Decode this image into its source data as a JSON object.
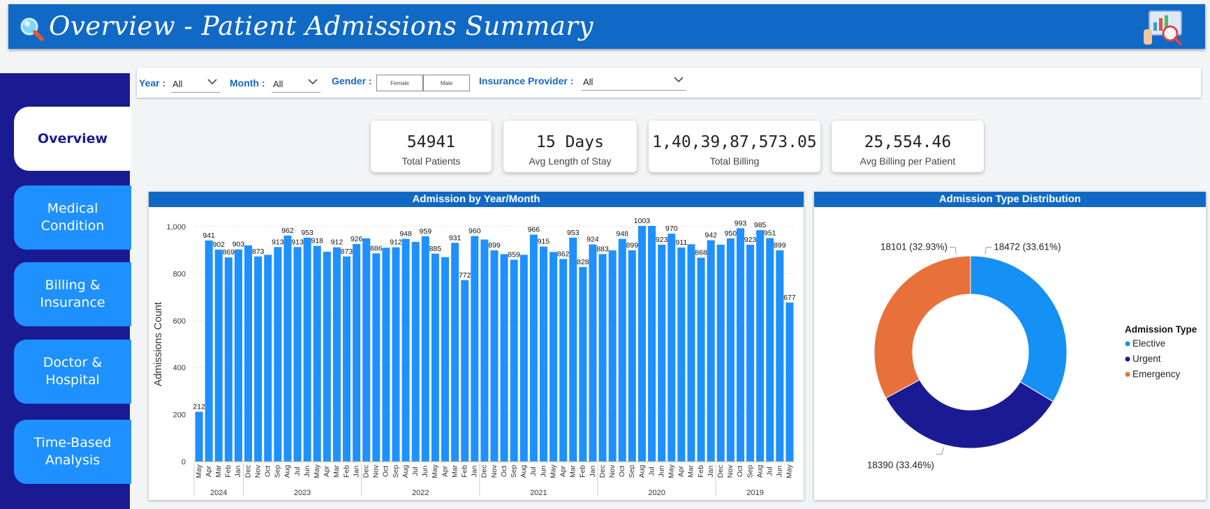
{
  "header": {
    "title": "Overview - Patient Admissions Summary",
    "left_icon": "magnifier-icon",
    "right_icon": "analytics-icon"
  },
  "sidebar": {
    "items": [
      {
        "label": "Overview",
        "active": true
      },
      {
        "label": "Medical\nCondition",
        "active": false
      },
      {
        "label": "Billing &\nInsurance",
        "active": false
      },
      {
        "label": "Doctor &\nHospital",
        "active": false
      },
      {
        "label": "Time-Based\nAnalysis",
        "active": false
      }
    ]
  },
  "filters": {
    "year_label": "Year :",
    "year_value": "All",
    "month_label": "Month :",
    "month_value": "All",
    "gender_label": "Gender :",
    "gender_options": [
      "Female",
      "Male"
    ],
    "insurance_label": "Insurance Provider :",
    "insurance_value": "All"
  },
  "kpis": [
    {
      "value": "54941",
      "label": "Total Patients"
    },
    {
      "value": "15 Days",
      "label": "Avg Length of Stay"
    },
    {
      "value": "1,40,39,87,573.05",
      "label": "Total Billing"
    },
    {
      "value": "25,554.46",
      "label": "Avg Billing per Patient"
    }
  ],
  "colors": {
    "header": "#1169c6",
    "sidebar": "#1a1a93",
    "nav": "#1e90ff",
    "bar": "#1e90ff",
    "elective": "#1590f5",
    "urgent": "#1a1a93",
    "emergency": "#e8703a"
  },
  "chart_data": [
    {
      "type": "bar",
      "title": "Admission by Year/Month",
      "ylabel": "Admissions Count",
      "ylim": [
        0,
        1000
      ],
      "yticks": [
        "0",
        "200",
        "400",
        "600",
        "800",
        "1,000"
      ],
      "categories": [
        "May",
        "Apr",
        "Mar",
        "Feb",
        "Jan",
        "Dec",
        "Nov",
        "Oct",
        "Sep",
        "Aug",
        "Jul",
        "Jun",
        "May",
        "Apr",
        "Mar",
        "Feb",
        "Jan",
        "Dec",
        "Nov",
        "Oct",
        "Sep",
        "Aug",
        "Jul",
        "Jun",
        "May",
        "Apr",
        "Mar",
        "Feb",
        "Jan",
        "Dec",
        "Nov",
        "Oct",
        "Sep",
        "Aug",
        "Jul",
        "Jun",
        "May",
        "Apr",
        "Mar",
        "Feb",
        "Jan",
        "Dec",
        "Nov",
        "Oct",
        "Sep",
        "Aug",
        "Jul",
        "Jun",
        "May",
        "Apr",
        "Mar",
        "Feb",
        "Jan",
        "Dec",
        "Nov",
        "Oct",
        "Sep",
        "Aug",
        "Jul",
        "Jun",
        "May"
      ],
      "values": [
        212,
        941,
        902,
        869,
        903,
        920,
        873,
        880,
        913,
        962,
        913,
        953,
        918,
        893,
        912,
        873,
        926,
        950,
        886,
        910,
        912,
        948,
        935,
        959,
        885,
        870,
        931,
        772,
        960,
        945,
        899,
        883,
        859,
        880,
        966,
        915,
        892,
        862,
        953,
        828,
        924,
        883,
        899,
        948,
        899,
        1003,
        1003,
        923,
        970,
        911,
        925,
        868,
        942,
        923,
        950,
        993,
        923,
        985,
        951,
        899,
        677
      ],
      "labels": [
        "212",
        "941",
        "902",
        "869",
        "903",
        "",
        "873",
        "",
        "913",
        "962",
        "913",
        "953",
        "918",
        "",
        "912",
        "873",
        "926",
        "",
        "886",
        "",
        "912",
        "948",
        "",
        "959",
        "885",
        "",
        "931",
        "772",
        "960",
        "",
        "899",
        "",
        "859",
        "",
        "966",
        "915",
        "",
        "862",
        "953",
        "828",
        "924",
        "883",
        "",
        "948",
        "899",
        "1003",
        "",
        "923",
        "970",
        "911",
        "",
        "868",
        "942",
        "",
        "950",
        "993",
        "923",
        "985",
        "951",
        "899",
        "677"
      ],
      "years": [
        {
          "label": "2024",
          "span": 5
        },
        {
          "label": "2023",
          "span": 12
        },
        {
          "label": "2022",
          "span": 12
        },
        {
          "label": "2021",
          "span": 12
        },
        {
          "label": "2020",
          "span": 12
        },
        {
          "label": "2019",
          "span": 8
        }
      ]
    },
    {
      "type": "pie",
      "title": "Admission Type Distribution",
      "legend_title": "Admission Type",
      "slices": [
        {
          "name": "Elective",
          "value": 18472,
          "label": "18472 (33.61%)"
        },
        {
          "name": "Urgent",
          "value": 18390,
          "label": "18390 (33.46%)"
        },
        {
          "name": "Emergency",
          "value": 18101,
          "label": "18101 (32.93%)"
        }
      ]
    }
  ]
}
